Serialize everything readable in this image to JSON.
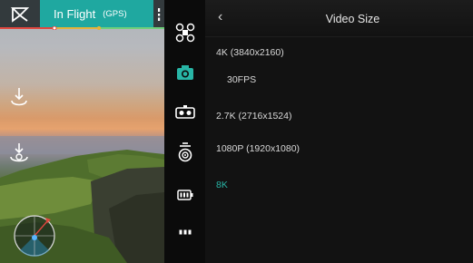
{
  "status_bar": {
    "logo_icon": "dji-go-logo-icon",
    "flight_mode": "In Flight",
    "signal": "(GPS)",
    "more_icon": "vertical-dots-icon",
    "chip_color": "#1fa8a0"
  },
  "left_tools": [
    {
      "name": "auto-takeoff-icon"
    },
    {
      "name": "return-to-home-icon"
    }
  ],
  "icon_bar": [
    {
      "name": "aircraft-settings-icon"
    },
    {
      "name": "camera-settings-icon",
      "selected": true
    },
    {
      "name": "remote-controller-icon"
    },
    {
      "name": "image-transmission-icon"
    },
    {
      "name": "battery-icon"
    },
    {
      "name": "more-settings-icon"
    }
  ],
  "panel": {
    "title": "Video Size",
    "back_icon": "back-chevron-icon",
    "accent_color": "#28b5a6",
    "options": [
      {
        "label": "4K (3840x2160)",
        "active": false,
        "sub": false
      },
      {
        "label": "30FPS",
        "active": false,
        "sub": true
      },
      {
        "label": "2.7K (2716x1524)",
        "active": false,
        "sub": false
      },
      {
        "label": "1080P (1920x1080)",
        "active": false,
        "sub": false
      },
      {
        "label": "8K",
        "active": true,
        "sub": false
      }
    ]
  }
}
